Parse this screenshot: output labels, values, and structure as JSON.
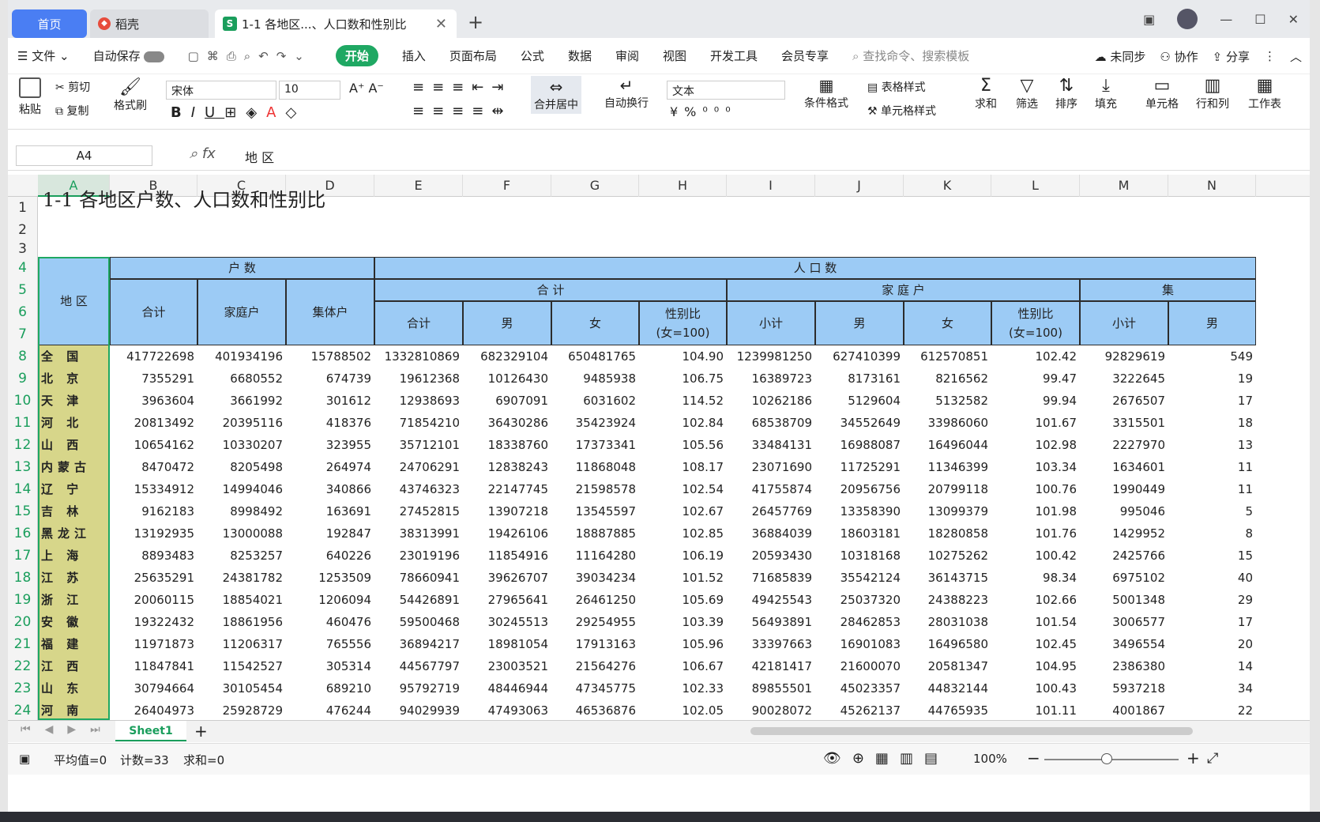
{
  "tabs": {
    "home": "首页",
    "docer": "稻壳",
    "file": "1-1 各地区...、人口数和性别比"
  },
  "menu": {
    "file": "文件",
    "autosave": "自动保存",
    "start": "开始",
    "items": [
      "插入",
      "页面布局",
      "公式",
      "数据",
      "审阅",
      "视图",
      "开发工具",
      "会员专享"
    ],
    "search": "查找命令、搜索模板",
    "sync": "未同步",
    "collab": "协作",
    "share": "分享"
  },
  "ribbon": {
    "paste": "粘贴",
    "cut": "剪切",
    "copy": "复制",
    "format_painter": "格式刷",
    "font": "宋体",
    "size": "10",
    "merge": "合并居中",
    "wrap": "自动换行",
    "numfmt": "文本",
    "cond": "条件格式",
    "table_style": "表格样式",
    "cell_style": "单元格样式",
    "sum": "求和",
    "filter": "筛选",
    "sort": "排序",
    "fill": "填充",
    "cell": "单元格",
    "rowcol": "行和列",
    "sheet": "工作表"
  },
  "formula": {
    "namebox": "A4",
    "fx": "fx",
    "content": "地 区"
  },
  "title": "1-1 各地区户数、人口数和性别比",
  "columns": [
    "A",
    "B",
    "C",
    "D",
    "E",
    "F",
    "G",
    "H",
    "I",
    "J",
    "K",
    "L",
    "M",
    "N"
  ],
  "rows_nums": [
    "1",
    "2",
    "3",
    "4",
    "5",
    "6",
    "7",
    "8",
    "9",
    "10",
    "11",
    "12",
    "13",
    "14",
    "15",
    "16",
    "17",
    "18",
    "19",
    "20",
    "21",
    "22",
    "23",
    "24"
  ],
  "header": {
    "region": "地 区",
    "households": "户 数",
    "population": "人 口 数",
    "total": "合 计",
    "family": "家 庭 户",
    "collective_cut": "集",
    "h_total": "合计",
    "h_family": "家庭户",
    "h_collective": "集体户",
    "p_total": "合计",
    "male": "男",
    "female": "女",
    "ratio": "性别比",
    "ratio_sub": "(女=100)",
    "subtotal": "小计",
    "m_cut": "男"
  },
  "data": [
    [
      "全 国",
      "417722698",
      "401934196",
      "15788502",
      "1332810869",
      "682329104",
      "650481765",
      "104.90",
      "1239981250",
      "627410399",
      "612570851",
      "102.42",
      "92829619",
      "549"
    ],
    [
      "北 京",
      "7355291",
      "6680552",
      "674739",
      "19612368",
      "10126430",
      "9485938",
      "106.75",
      "16389723",
      "8173161",
      "8216562",
      "99.47",
      "3222645",
      "19"
    ],
    [
      "天 津",
      "3963604",
      "3661992",
      "301612",
      "12938693",
      "6907091",
      "6031602",
      "114.52",
      "10262186",
      "5129604",
      "5132582",
      "99.94",
      "2676507",
      "17"
    ],
    [
      "河 北",
      "20813492",
      "20395116",
      "418376",
      "71854210",
      "36430286",
      "35423924",
      "102.84",
      "68538709",
      "34552649",
      "33986060",
      "101.67",
      "3315501",
      "18"
    ],
    [
      "山 西",
      "10654162",
      "10330207",
      "323955",
      "35712101",
      "18338760",
      "17373341",
      "105.56",
      "33484131",
      "16988087",
      "16496044",
      "102.98",
      "2227970",
      "13"
    ],
    [
      "内蒙古",
      "8470472",
      "8205498",
      "264974",
      "24706291",
      "12838243",
      "11868048",
      "108.17",
      "23071690",
      "11725291",
      "11346399",
      "103.34",
      "1634601",
      "11"
    ],
    [
      "辽 宁",
      "15334912",
      "14994046",
      "340866",
      "43746323",
      "22147745",
      "21598578",
      "102.54",
      "41755874",
      "20956756",
      "20799118",
      "100.76",
      "1990449",
      "11"
    ],
    [
      "吉 林",
      "9162183",
      "8998492",
      "163691",
      "27452815",
      "13907218",
      "13545597",
      "102.67",
      "26457769",
      "13358390",
      "13099379",
      "101.98",
      "995046",
      "5"
    ],
    [
      "黑龙江",
      "13192935",
      "13000088",
      "192847",
      "38313991",
      "19426106",
      "18887885",
      "102.85",
      "36884039",
      "18603181",
      "18280858",
      "101.76",
      "1429952",
      "8"
    ],
    [
      "上 海",
      "8893483",
      "8253257",
      "640226",
      "23019196",
      "11854916",
      "11164280",
      "106.19",
      "20593430",
      "10318168",
      "10275262",
      "100.42",
      "2425766",
      "15"
    ],
    [
      "江 苏",
      "25635291",
      "24381782",
      "1253509",
      "78660941",
      "39626707",
      "39034234",
      "101.52",
      "71685839",
      "35542124",
      "36143715",
      "98.34",
      "6975102",
      "40"
    ],
    [
      "浙 江",
      "20060115",
      "18854021",
      "1206094",
      "54426891",
      "27965641",
      "26461250",
      "105.69",
      "49425543",
      "25037320",
      "24388223",
      "102.66",
      "5001348",
      "29"
    ],
    [
      "安 徽",
      "19322432",
      "18861956",
      "460476",
      "59500468",
      "30245513",
      "29254955",
      "103.39",
      "56493891",
      "28462853",
      "28031038",
      "101.54",
      "3006577",
      "17"
    ],
    [
      "福 建",
      "11971873",
      "11206317",
      "765556",
      "36894217",
      "18981054",
      "17913163",
      "105.96",
      "33397663",
      "16901083",
      "16496580",
      "102.45",
      "3496554",
      "20"
    ],
    [
      "江 西",
      "11847841",
      "11542527",
      "305314",
      "44567797",
      "23003521",
      "21564276",
      "106.67",
      "42181417",
      "21600070",
      "20581347",
      "104.95",
      "2386380",
      "14"
    ],
    [
      "山 东",
      "30794664",
      "30105454",
      "689210",
      "95792719",
      "48446944",
      "47345775",
      "102.33",
      "89855501",
      "45023357",
      "44832144",
      "100.43",
      "5937218",
      "34"
    ],
    [
      "河 南",
      "26404973",
      "25928729",
      "476244",
      "94029939",
      "47493063",
      "46536876",
      "102.05",
      "90028072",
      "45262137",
      "44765935",
      "101.11",
      "4001867",
      "22"
    ]
  ],
  "sheet": {
    "name": "Sheet1"
  },
  "status": {
    "avg": "平均值=0",
    "count": "计数=33",
    "sum": "求和=0",
    "zoom": "100%"
  }
}
